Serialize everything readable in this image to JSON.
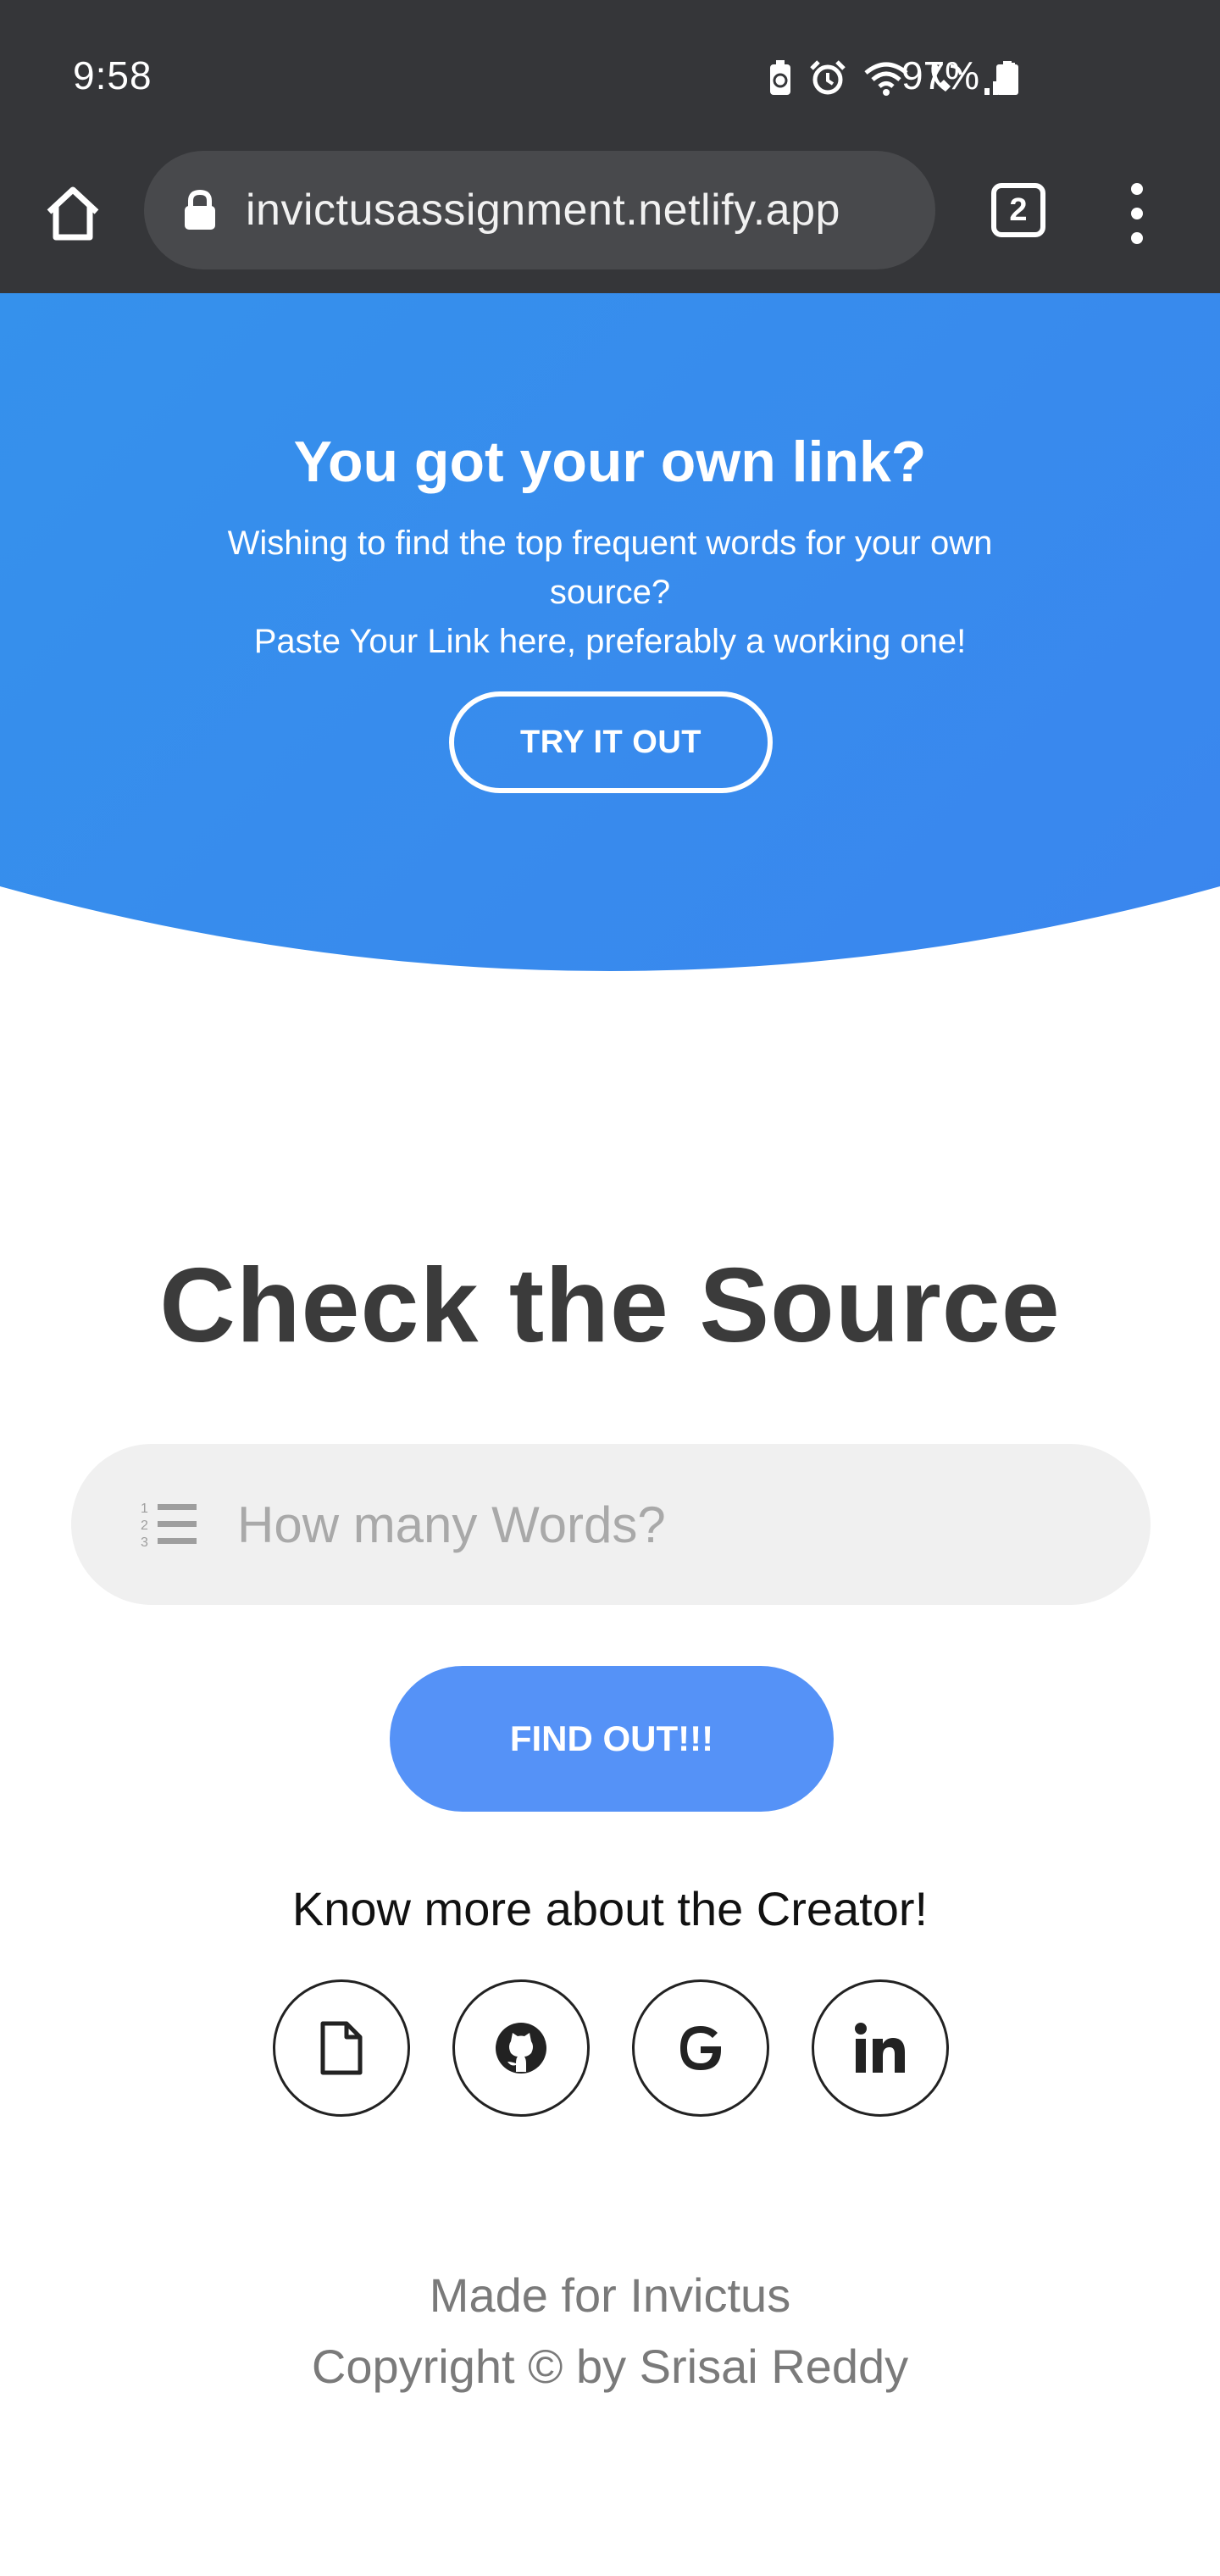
{
  "status_bar": {
    "time": "9:58",
    "battery": "97%",
    "icons": [
      "battery-saver-icon",
      "alarm-icon",
      "wifi-icon",
      "wifi-call-icon",
      "signal-icon",
      "battery-icon"
    ]
  },
  "browser": {
    "url": "invictusassignment.netlify.app",
    "tab_count": "2"
  },
  "hero": {
    "title": "You got your own link?",
    "subtitle_line1": "Wishing to find the top frequent words for your own source?",
    "subtitle_line2": "Paste Your Link here, preferably a working one!",
    "button_label": "TRY IT OUT"
  },
  "main": {
    "title": "Check the Source",
    "input_placeholder": "How many Words?",
    "button_label": "FIND OUT!!!",
    "creator_text": "Know more about the Creator!",
    "social_icons": [
      "document-icon",
      "github-icon",
      "google-icon",
      "linkedin-icon"
    ]
  },
  "footer": {
    "line1": "Made for Invictus",
    "line2": "Copyright © by Srisai Reddy"
  },
  "colors": {
    "browser_chrome": "#353639",
    "hero_blue": "#3591ec",
    "button_blue": "#5592f7",
    "title_text": "#3b3b3b"
  }
}
